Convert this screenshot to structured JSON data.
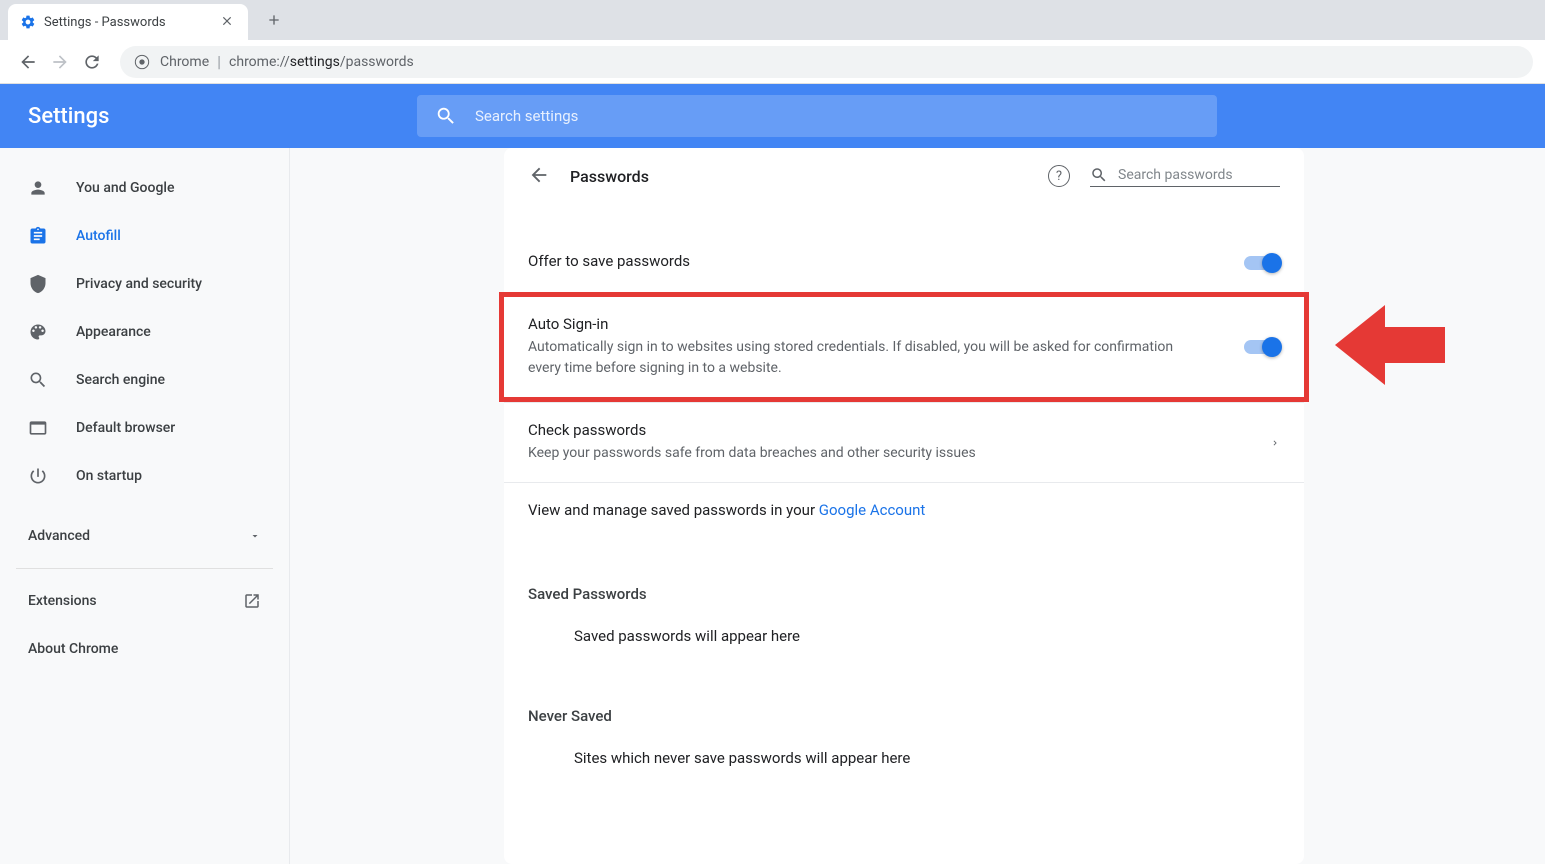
{
  "browser": {
    "tab_title": "Settings - Passwords",
    "url_label": "Chrome",
    "url_prefix": "chrome://",
    "url_highlight": "settings",
    "url_suffix": "/passwords"
  },
  "header": {
    "title": "Settings",
    "search_placeholder": "Search settings"
  },
  "sidebar": {
    "items": [
      {
        "label": "You and Google",
        "icon": "person"
      },
      {
        "label": "Autofill",
        "icon": "clipboard",
        "active": true
      },
      {
        "label": "Privacy and security",
        "icon": "shield"
      },
      {
        "label": "Appearance",
        "icon": "palette"
      },
      {
        "label": "Search engine",
        "icon": "search"
      },
      {
        "label": "Default browser",
        "icon": "browser"
      },
      {
        "label": "On startup",
        "icon": "power"
      }
    ],
    "advanced": "Advanced",
    "extensions": "Extensions",
    "about": "About Chrome"
  },
  "content": {
    "title": "Passwords",
    "search_placeholder": "Search passwords",
    "offer_save": {
      "title": "Offer to save passwords"
    },
    "auto_signin": {
      "title": "Auto Sign-in",
      "subtitle": "Automatically sign in to websites using stored credentials. If disabled, you will be asked for confirmation every time before signing in to a website."
    },
    "check_pw": {
      "title": "Check passwords",
      "subtitle": "Keep your passwords safe from data breaches and other security issues"
    },
    "view_manage_prefix": "View and manage saved passwords in your ",
    "view_manage_link": "Google Account",
    "saved_header": "Saved Passwords",
    "saved_empty": "Saved passwords will appear here",
    "never_header": "Never Saved",
    "never_empty": "Sites which never save passwords will appear here"
  }
}
